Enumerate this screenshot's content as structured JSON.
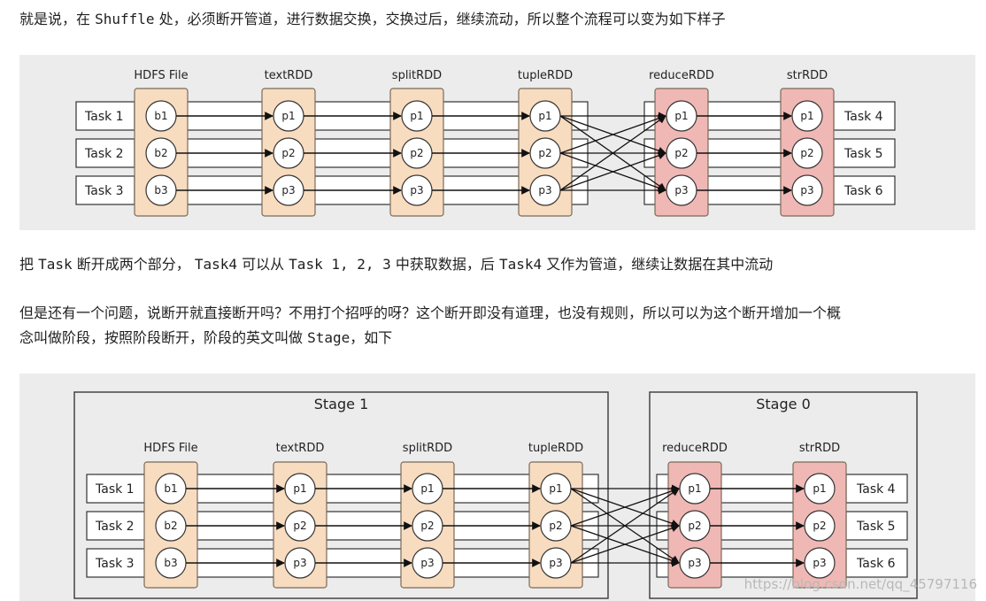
{
  "p1": {
    "before": "就是说，在 ",
    "code": "Shuffle",
    "after": " 处，必须断开管道，进行数据交换，交换过后，继续流动，所以整个流程可以变为如下样子"
  },
  "p2": {
    "a": "把 ",
    "c1": "Task",
    "b": " 断开成两个部分， ",
    "c2": "Task4",
    "c": " 可以从 ",
    "c3": "Task 1, 2, 3",
    "d": " 中获取数据，后 ",
    "c4": "Task4",
    "e": " 又作为管道，继续让数据在其中流动"
  },
  "p3": {
    "line1": "但是还有一个问题，说断开就直接断开吗？不用打个招呼的呀？这个断开即没有道理，也没有规则，所以可以为这个断开增加一个概",
    "line2_before": "念叫做阶段，按照阶段断开，阶段的英文叫做 ",
    "line2_code": "Stage",
    "line2_after": "，如下"
  },
  "diagram": {
    "columns": [
      "HDFS File",
      "textRDD",
      "splitRDD",
      "tupleRDD",
      "reduceRDD",
      "strRDD"
    ],
    "source_partitions": [
      "b1",
      "b2",
      "b3"
    ],
    "partitions": [
      "p1",
      "p2",
      "p3"
    ],
    "left_tasks": [
      "Task 1",
      "Task 2",
      "Task 3"
    ],
    "right_tasks": [
      "Task 4",
      "Task 5",
      "Task 6"
    ],
    "stages": [
      "Stage 1",
      "Stage 0"
    ]
  },
  "colors": {
    "orange_fill": "#f8dcc0",
    "pink_fill": "#f0b8b4",
    "panel_bg": "#ececec"
  },
  "watermark": "https://blog.csdn.net/qq_45797116"
}
